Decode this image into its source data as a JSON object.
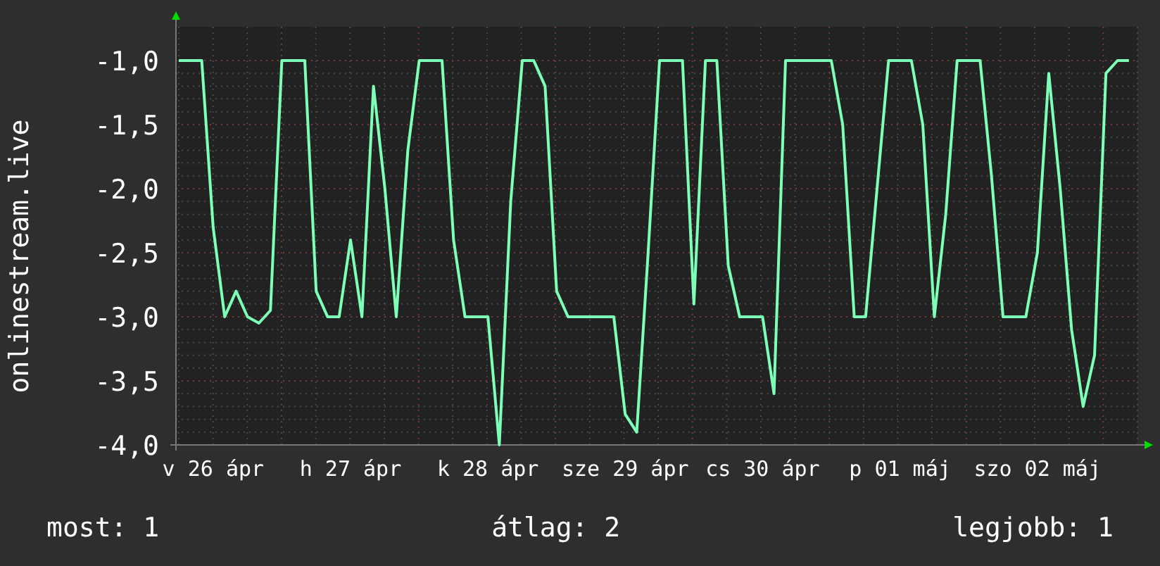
{
  "chart": {
    "chart_data": {
      "type": "line",
      "ylabel": "onlinestream.live",
      "categories": [
        null,
        null,
        null,
        "v 26 ápr",
        null,
        null,
        null,
        null,
        null,
        null,
        null,
        null,
        null,
        null,
        null,
        "h 27 ápr",
        null,
        null,
        null,
        null,
        null,
        null,
        null,
        null,
        null,
        null,
        null,
        "k 28 ápr",
        null,
        null,
        null,
        null,
        null,
        null,
        null,
        null,
        null,
        null,
        null,
        "sze 29 ápr",
        null,
        null,
        null,
        null,
        null,
        null,
        null,
        null,
        null,
        null,
        null,
        "cs 30 ápr",
        null,
        null,
        null,
        null,
        null,
        null,
        null,
        null,
        null,
        null,
        null,
        "p 01 máj",
        null,
        null,
        null,
        null,
        null,
        null,
        null,
        null,
        null,
        null,
        null,
        "szo 02 máj",
        null,
        null,
        null,
        null,
        null,
        null,
        null,
        null
      ],
      "series": [
        {
          "color": "#7dffb8",
          "values": [
            -1.0,
            -1.0,
            -1.0,
            -2.3,
            -3.0,
            -2.8,
            -3.0,
            -3.05,
            -2.95,
            -1.0,
            -1.0,
            -1.0,
            -2.8,
            -3.0,
            -3.0,
            -2.4,
            -3.0,
            -1.2,
            -2.0,
            -3.0,
            -1.7,
            -1.0,
            -1.0,
            -1.0,
            -2.4,
            -3.0,
            -3.0,
            -3.0,
            -4.0,
            -2.1,
            -1.0,
            -1.0,
            -1.2,
            -2.8,
            -3.0,
            -3.0,
            -3.0,
            -3.0,
            -3.0,
            -3.76,
            -3.9,
            -2.5,
            -1.0,
            -1.0,
            -1.0,
            -2.9,
            -1.0,
            -1.0,
            -2.6,
            -3.0,
            -3.0,
            -3.0,
            -3.6,
            -1.0,
            -1.0,
            -1.0,
            -1.0,
            -1.0,
            -1.5,
            -3.0,
            -3.0,
            -2.0,
            -1.0,
            -1.0,
            -1.0,
            -1.5,
            -3.0,
            -2.2,
            -1.0,
            -1.0,
            -1.0,
            -1.9,
            -3.0,
            -3.0,
            -3.0,
            -2.5,
            -1.1,
            -2.0,
            -3.1,
            -3.7,
            -3.3,
            -1.1,
            -1.0,
            -1.0
          ]
        }
      ],
      "grid": true,
      "ylim": [
        -4.0,
        -1.0
      ],
      "yticks": [
        {
          "value": -1.0,
          "label": "-1,0"
        },
        {
          "value": -1.5,
          "label": "-1,5"
        },
        {
          "value": -2.0,
          "label": "-2,0"
        },
        {
          "value": -2.5,
          "label": "-2,5"
        },
        {
          "value": -3.0,
          "label": "-3,0"
        },
        {
          "value": -3.5,
          "label": "-3,5"
        },
        {
          "value": -4.0,
          "label": "-4,0"
        }
      ]
    }
  },
  "stats": [
    "most: 1",
    "átlag: 2",
    "legjobb: 1"
  ]
}
